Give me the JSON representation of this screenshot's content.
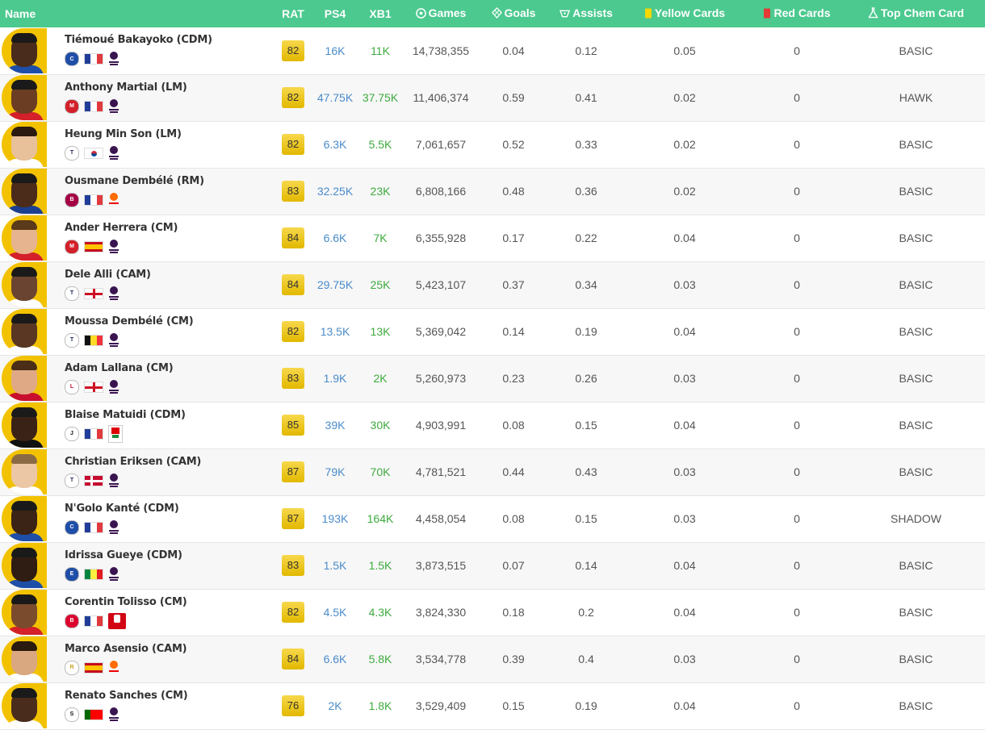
{
  "header": {
    "name": "Name",
    "rat": "RAT",
    "ps4": "PS4",
    "xb1": "XB1",
    "games": "Games",
    "goals": "Goals",
    "assists": "Assists",
    "yellow": "Yellow Cards",
    "red": "Red Cards",
    "chem": "Top Chem Card",
    "icons": {
      "games": "soccer-ball-icon",
      "goals": "goal-net-icon",
      "assists": "boot-icon",
      "yellow": "yellow-card-icon",
      "red": "red-card-icon",
      "chem": "flask-icon"
    }
  },
  "players": [
    {
      "name": "Tiémoué Bakayoko (CDM)",
      "rat": "82",
      "ps4": "16K",
      "xb1": "11K",
      "games": "14,738,355",
      "goals": "0.04",
      "assists": "0.12",
      "yellow": "0.05",
      "red": "0",
      "chem": "BASIC",
      "club": "chelsea",
      "nation": "france",
      "league": "premier-league"
    },
    {
      "name": "Anthony Martial (LM)",
      "rat": "82",
      "ps4": "47.75K",
      "xb1": "37.75K",
      "games": "11,406,374",
      "goals": "0.59",
      "assists": "0.41",
      "yellow": "0.02",
      "red": "0",
      "chem": "HAWK",
      "club": "man-utd",
      "nation": "france",
      "league": "premier-league"
    },
    {
      "name": "Heung Min Son (LM)",
      "rat": "82",
      "ps4": "6.3K",
      "xb1": "5.5K",
      "games": "7,061,657",
      "goals": "0.52",
      "assists": "0.33",
      "yellow": "0.02",
      "red": "0",
      "chem": "BASIC",
      "club": "tottenham",
      "nation": "korea",
      "league": "premier-league"
    },
    {
      "name": "Ousmane Dembélé (RM)",
      "rat": "83",
      "ps4": "32.25K",
      "xb1": "23K",
      "games": "6,808,166",
      "goals": "0.48",
      "assists": "0.36",
      "yellow": "0.02",
      "red": "0",
      "chem": "BASIC",
      "club": "barcelona",
      "nation": "france",
      "league": "laliga"
    },
    {
      "name": "Ander Herrera (CM)",
      "rat": "84",
      "ps4": "6.6K",
      "xb1": "7K",
      "games": "6,355,928",
      "goals": "0.17",
      "assists": "0.22",
      "yellow": "0.04",
      "red": "0",
      "chem": "BASIC",
      "club": "man-utd",
      "nation": "spain",
      "league": "premier-league"
    },
    {
      "name": "Dele Alli (CAM)",
      "rat": "84",
      "ps4": "29.75K",
      "xb1": "25K",
      "games": "5,423,107",
      "goals": "0.37",
      "assists": "0.34",
      "yellow": "0.03",
      "red": "0",
      "chem": "BASIC",
      "club": "tottenham",
      "nation": "england",
      "league": "premier-league"
    },
    {
      "name": "Moussa Dembélé (CM)",
      "rat": "82",
      "ps4": "13.5K",
      "xb1": "13K",
      "games": "5,369,042",
      "goals": "0.14",
      "assists": "0.19",
      "yellow": "0.04",
      "red": "0",
      "chem": "BASIC",
      "club": "tottenham",
      "nation": "belgium",
      "league": "premier-league"
    },
    {
      "name": "Adam Lallana (CM)",
      "rat": "83",
      "ps4": "1.9K",
      "xb1": "2K",
      "games": "5,260,973",
      "goals": "0.23",
      "assists": "0.26",
      "yellow": "0.03",
      "red": "0",
      "chem": "BASIC",
      "club": "liverpool",
      "nation": "england",
      "league": "premier-league"
    },
    {
      "name": "Blaise Matuidi (CDM)",
      "rat": "85",
      "ps4": "39K",
      "xb1": "30K",
      "games": "4,903,991",
      "goals": "0.08",
      "assists": "0.15",
      "yellow": "0.04",
      "red": "0",
      "chem": "BASIC",
      "club": "juventus",
      "nation": "france",
      "league": "calcio"
    },
    {
      "name": "Christian Eriksen (CAM)",
      "rat": "87",
      "ps4": "79K",
      "xb1": "70K",
      "games": "4,781,521",
      "goals": "0.44",
      "assists": "0.43",
      "yellow": "0.03",
      "red": "0",
      "chem": "BASIC",
      "club": "tottenham",
      "nation": "denmark",
      "league": "premier-league"
    },
    {
      "name": "N'Golo Kanté (CDM)",
      "rat": "87",
      "ps4": "193K",
      "xb1": "164K",
      "games": "4,458,054",
      "goals": "0.08",
      "assists": "0.15",
      "yellow": "0.03",
      "red": "0",
      "chem": "SHADOW",
      "club": "chelsea",
      "nation": "france",
      "league": "premier-league"
    },
    {
      "name": "Idrissa Gueye (CDM)",
      "rat": "83",
      "ps4": "1.5K",
      "xb1": "1.5K",
      "games": "3,873,515",
      "goals": "0.07",
      "assists": "0.14",
      "yellow": "0.04",
      "red": "0",
      "chem": "BASIC",
      "club": "everton",
      "nation": "senegal",
      "league": "premier-league"
    },
    {
      "name": "Corentin Tolisso (CM)",
      "rat": "82",
      "ps4": "4.5K",
      "xb1": "4.3K",
      "games": "3,824,330",
      "goals": "0.18",
      "assists": "0.2",
      "yellow": "0.04",
      "red": "0",
      "chem": "BASIC",
      "club": "bayern",
      "nation": "france",
      "league": "bundesliga"
    },
    {
      "name": "Marco Asensio (CAM)",
      "rat": "84",
      "ps4": "6.6K",
      "xb1": "5.8K",
      "games": "3,534,778",
      "goals": "0.39",
      "assists": "0.4",
      "yellow": "0.03",
      "red": "0",
      "chem": "BASIC",
      "club": "real-madrid",
      "nation": "spain",
      "league": "laliga"
    },
    {
      "name": "Renato Sanches (CM)",
      "rat": "76",
      "ps4": "2K",
      "xb1": "1.8K",
      "games": "3,529,409",
      "goals": "0.15",
      "assists": "0.19",
      "yellow": "0.04",
      "red": "0",
      "chem": "BASIC",
      "club": "swansea",
      "nation": "portugal",
      "league": "premier-league"
    }
  ]
}
